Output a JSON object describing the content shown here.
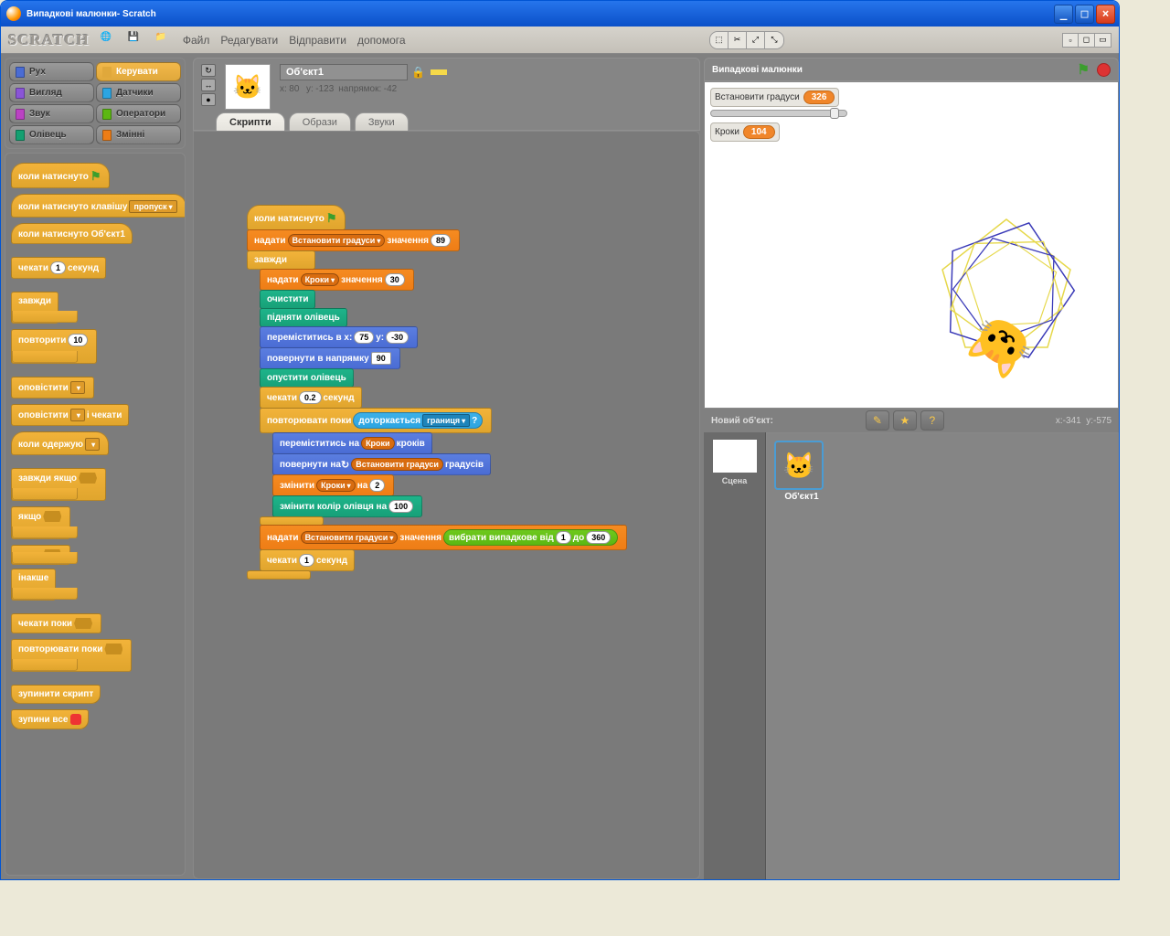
{
  "window": {
    "title": "Випадкові малюнки- Scratch"
  },
  "logo": "SCRATCH",
  "menu": {
    "file": "Файл",
    "edit": "Редагувати",
    "share": "Відправити",
    "help": "допомога"
  },
  "categories": {
    "motion": "Рух",
    "control": "Керувати",
    "looks": "Вигляд",
    "sensing": "Датчики",
    "sound": "Звук",
    "operators": "Оператори",
    "pen": "Олівець",
    "variables": "Змінні"
  },
  "palette": {
    "when_flag": "коли натиснуто",
    "when_key": "коли натиснуто клавішу",
    "when_key_arg": "пропуск",
    "when_sprite": "коли натиснуто Об'єкт1",
    "wait": "чекати",
    "wait_arg": "1",
    "seconds": "секунд",
    "forever": "завжди",
    "repeat": "повторити",
    "repeat_arg": "10",
    "broadcast": "оповістити",
    "broadcast_wait": "і чекати",
    "when_receive": "коли одержую",
    "forever_if": "завжди якщо",
    "if": "якщо",
    "else": "інакше",
    "wait_until": "чекати поки",
    "repeat_until": "повторювати поки",
    "stop_script": "зупинити скрипт",
    "stop_all": "зупини все"
  },
  "sprite": {
    "name": "Об'єкт1",
    "x": "80",
    "y": "-123",
    "dir": "-42",
    "info_prefix_x": "x:",
    "info_prefix_y": "у:",
    "info_dir": "напрямок:"
  },
  "tabs": {
    "scripts": "Скрипти",
    "costumes": "Образи",
    "sounds": "Звуки"
  },
  "script": {
    "when_flag": "коли натиснуто",
    "set": "надати",
    "var_degrees": "Встановити градуси",
    "value_word": "значення",
    "val89": "89",
    "forever": "завжди",
    "var_steps": "Кроки",
    "val30": "30",
    "clear": "очистити",
    "penup": "підняти олівець",
    "goto": "переміститись в x:",
    "gx": "75",
    "goto_y": "у:",
    "gy": "-30",
    "point": "повернути в напрямку",
    "pdir": "90",
    "pendown": "опустити олівець",
    "wait": "чекати",
    "w02": "0.2",
    "seconds": "секунд",
    "repeat_until": "повторювати поки",
    "touching": "доторкається",
    "edge": "границя",
    "q": "?",
    "move": "переміститись на",
    "steps_word": "кроків",
    "turn": "повернути на",
    "deg_word": "градусів",
    "change": "змінити",
    "by_word": "на",
    "by2": "2",
    "change_pen": "змінити колір олівця на",
    "pen100": "100",
    "pick_random": "вибрати випадкове від",
    "r1": "1",
    "to_word": "до",
    "r360": "360",
    "w1": "1"
  },
  "stage": {
    "title": "Випадкові малюнки",
    "var_degrees_label": "Встановити градуси",
    "var_degrees_val": "326",
    "var_steps_label": "Кроки",
    "var_steps_val": "104",
    "mouse_x": "-341",
    "mouse_y": "-575",
    "info_x": "x:",
    "info_y": "y:"
  },
  "newobj": {
    "label": "Новий об'єкт:"
  },
  "scene": {
    "label": "Сцена"
  },
  "spritelist": {
    "item1": "Об'єкт1"
  }
}
